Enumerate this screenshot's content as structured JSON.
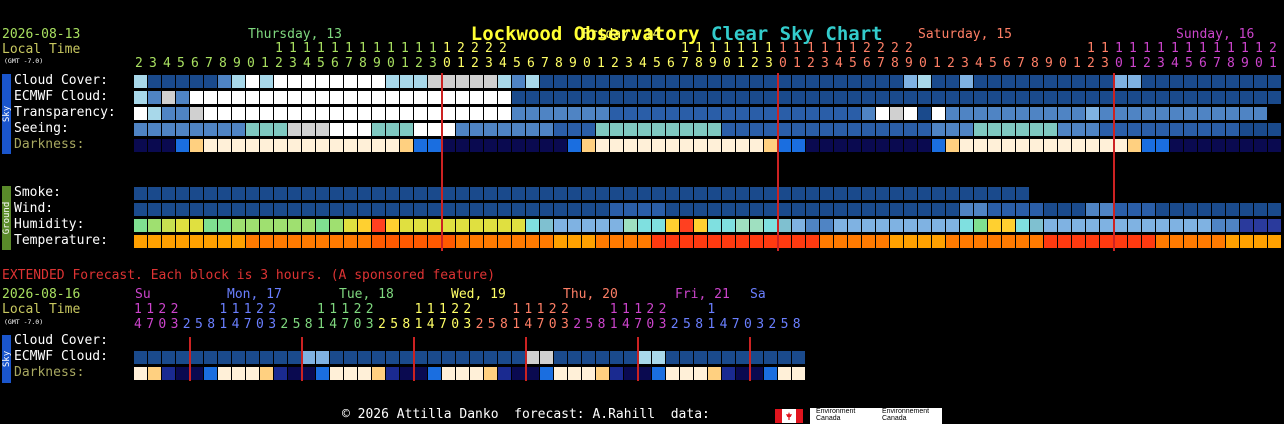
{
  "header": {
    "title_part1": "Lockwood Observatory",
    "title_part2": "Clear Sky Chart",
    "date": "2026-08-13",
    "local_time": "Local Time",
    "gmt": "(GMT -7.0)"
  },
  "days": [
    {
      "label": "Thursday, 13",
      "color": "#7fd87f"
    },
    {
      "label": "Friday, 14",
      "color": "#ffff66"
    },
    {
      "label": "Saturday, 15",
      "color": "#ff7f66"
    },
    {
      "label": "Sunday, 16",
      "color": "#cc44cc"
    }
  ],
  "hour_digits_row1": "          11111111111112222            11111111111112222            11111111111112222            11",
  "hour_digits_row2": "23456789012345678901230123456789012345678901230123456789012345678901230123456789012345678901230123456789012345678901",
  "hour_digit_colors": {
    "a": "#a8e060",
    "b": "#ffff66",
    "c": "#ff7f66",
    "d": "#cc44cc"
  },
  "sky_label": "Sky",
  "ground_label": "Ground",
  "rows_main": [
    {
      "label": "Cloud Cover:",
      "key": "cloud"
    },
    {
      "label": "ECMWF Cloud:",
      "key": "ecmwf"
    },
    {
      "label": "Transparency:",
      "key": "transp"
    },
    {
      "label": "Seeing:",
      "key": "seeing"
    },
    {
      "label": "Darkness:",
      "key": "dark"
    }
  ],
  "rows_ground": [
    {
      "label": "Smoke:",
      "key": "smoke"
    },
    {
      "label": "Wind:",
      "key": "wind"
    },
    {
      "label": "Humidity:",
      "key": "hum"
    },
    {
      "label": "Temperature:",
      "key": "temp"
    }
  ],
  "extended": {
    "notice": "EXTENDED Forecast. Each block is 3 hours. (A sponsored feature)",
    "date": "2026-08-16",
    "local_time": "Local Time",
    "gmt": "(GMT -7.0)",
    "days": [
      {
        "label": "Su",
        "color": "#cc44cc"
      },
      {
        "label": "Mon, 17",
        "color": "#6a7fff"
      },
      {
        "label": "Tue, 18",
        "color": "#7fd87f"
      },
      {
        "label": "Wed, 19",
        "color": "#ffff66"
      },
      {
        "label": "Thu, 20",
        "color": "#ff7f66"
      },
      {
        "label": "Fri, 21",
        "color": "#cc44cc"
      },
      {
        "label": "Sa",
        "color": "#6a7fff"
      }
    ],
    "hour_row1": "1122   11122   11122   11122   11122   11122   1",
    "hour_row2": "4703258147032581470325814703258147032581470325814703258",
    "rows": [
      {
        "label": "Cloud Cover:",
        "key": "xcloud"
      },
      {
        "label": "ECMWF Cloud:",
        "key": "xecmwf"
      },
      {
        "label": "Darkness:",
        "key": "xdark"
      }
    ]
  },
  "footer": {
    "copyright": "© 2026 Attilla Danko  forecast: A.Rahill  data:",
    "env1": "Environment",
    "env2": "Canada",
    "env3": "Environnement",
    "env4": "Canada"
  },
  "colors": {
    "title1": "#ffff33",
    "title2": "#33cccc",
    "date": "#a8e060",
    "local_time": "#c8c860",
    "label": "#ffffff",
    "darkness_label": "#a8a860",
    "extended_notice": "#dd3333",
    "vline": "#cc2222"
  }
}
